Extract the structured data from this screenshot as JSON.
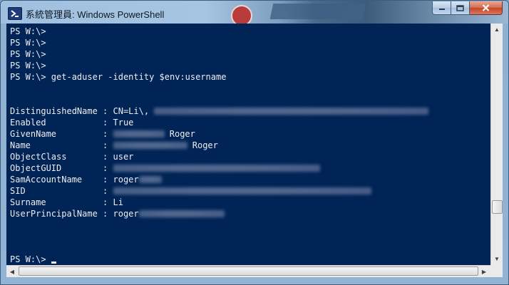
{
  "window": {
    "title": "系統管理員: Windows PowerShell",
    "icon": "powershell-icon"
  },
  "caption": {
    "minimize_icon": "minimize-icon",
    "maximize_icon": "maximize-icon",
    "close_icon": "close-icon"
  },
  "console": {
    "lines": [
      {
        "text": "PS W:\\>"
      },
      {
        "text": "PS W:\\>"
      },
      {
        "text": "PS W:\\>"
      },
      {
        "text": "PS W:\\>"
      },
      {
        "text": "PS W:\\> get-aduser -identity $env:username"
      },
      {
        "text": ""
      },
      {
        "text": ""
      },
      {
        "text": "DistinguishedName : CN=Li\\,"
      },
      {
        "text": "Enabled           : True"
      },
      {
        "text": "GivenName         :"
      },
      {
        "text": "Name              :"
      },
      {
        "text": "ObjectClass       : user"
      },
      {
        "text": "ObjectGUID        :"
      },
      {
        "text": "SamAccountName    : roger"
      },
      {
        "text": "SID               :"
      },
      {
        "text": "Surname           : Li"
      },
      {
        "text": "UserPrincipalName : roger"
      },
      {
        "text": ""
      },
      {
        "text": ""
      },
      {
        "text": ""
      },
      {
        "text": "PS W:\\> "
      }
    ],
    "given_name_suffix": "Roger",
    "name_suffix": "Roger"
  },
  "scrollbar": {
    "vertical_position": 0.95
  }
}
